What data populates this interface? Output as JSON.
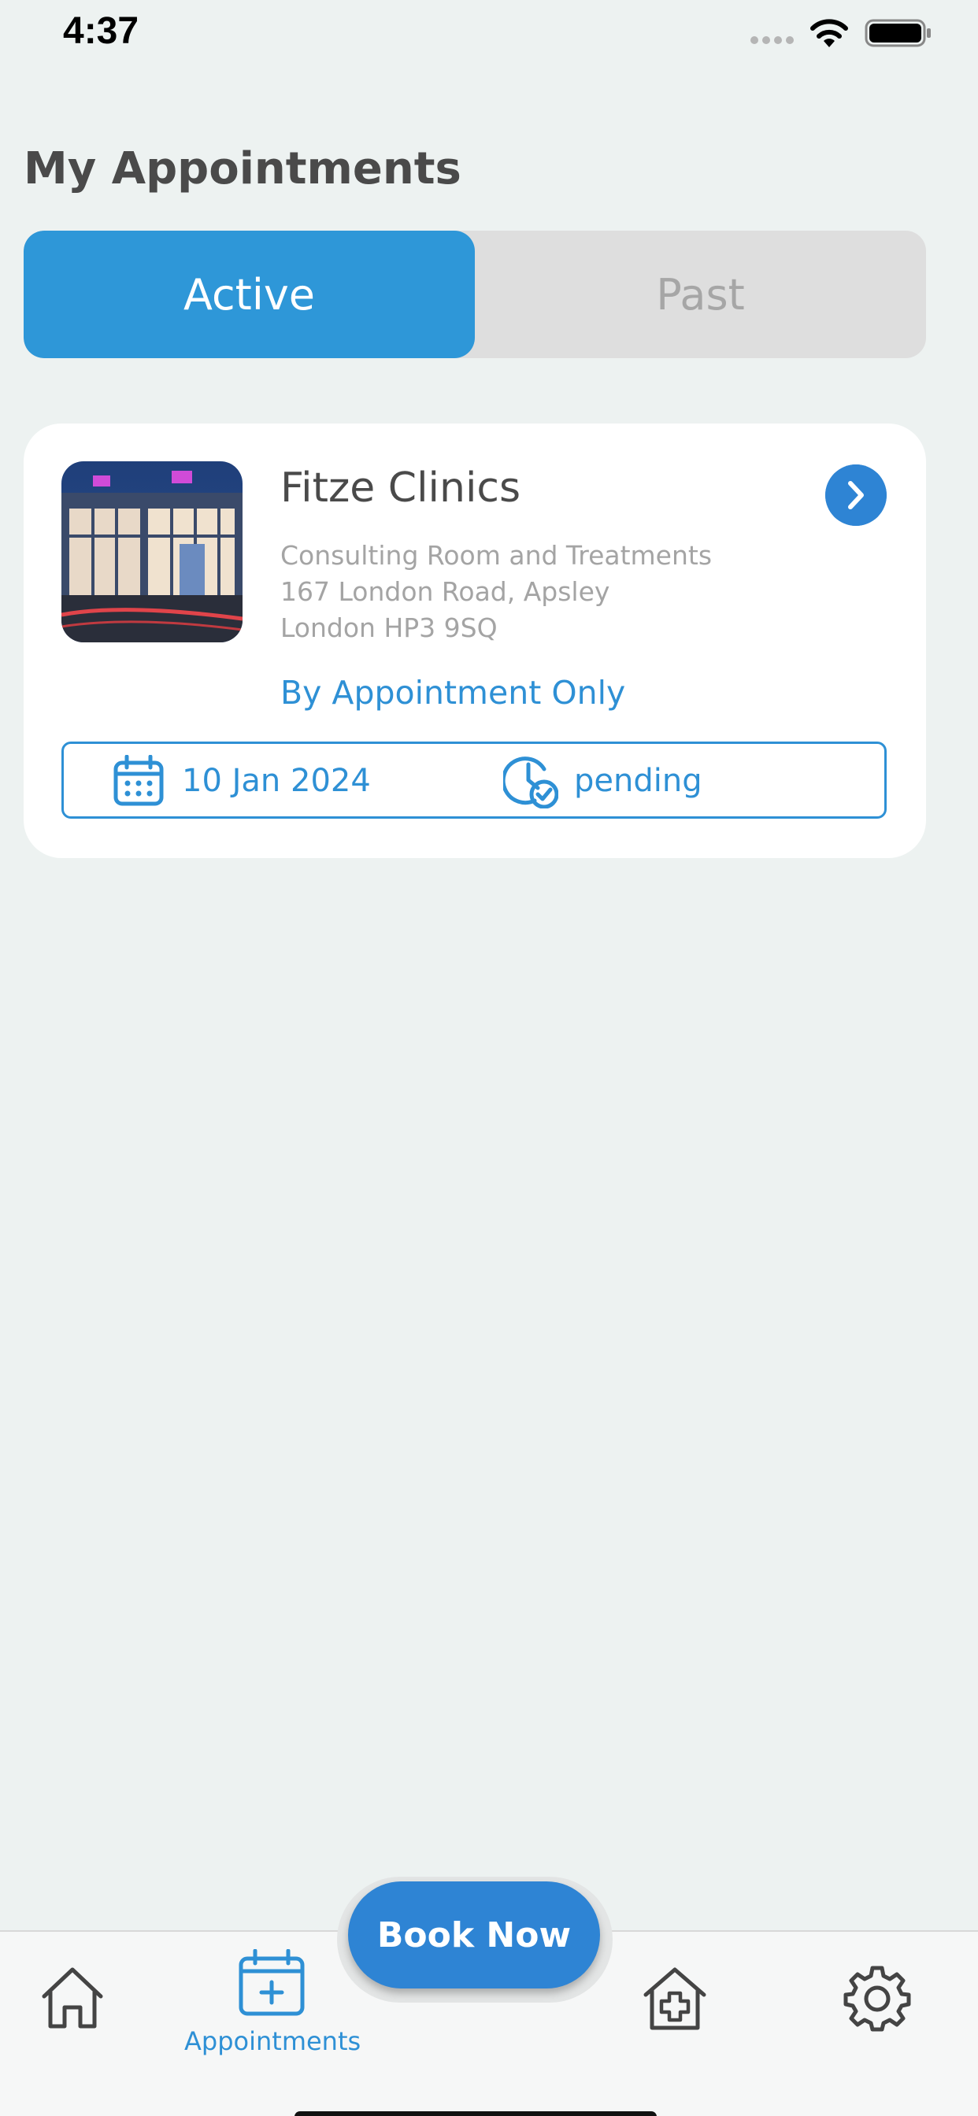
{
  "status_bar": {
    "time": "4:37"
  },
  "header": {
    "title": "My Appointments"
  },
  "tabs": {
    "active_label": "Active",
    "past_label": "Past",
    "selected": "Active"
  },
  "appointment": {
    "clinic_name": "Fitze Clinics",
    "address_lines": [
      "Consulting Room and Treatments",
      "167 London Road, Apsley",
      "London HP3 9SQ"
    ],
    "note": "By Appointment Only",
    "date": "10 Jan 2024",
    "status": "pending"
  },
  "bottom_nav": {
    "items": [
      {
        "icon": "home-icon",
        "label": ""
      },
      {
        "icon": "calendar-plus-icon",
        "label": "Appointments",
        "active": true
      },
      {
        "icon": "clinic-plus-icon",
        "label": ""
      },
      {
        "icon": "gear-icon",
        "label": ""
      }
    ],
    "book_now": "Book Now"
  },
  "colors": {
    "accent": "#2e90d5",
    "background": "#edf2f1",
    "segment_inactive": "#dedede",
    "card": "#ffffff"
  }
}
